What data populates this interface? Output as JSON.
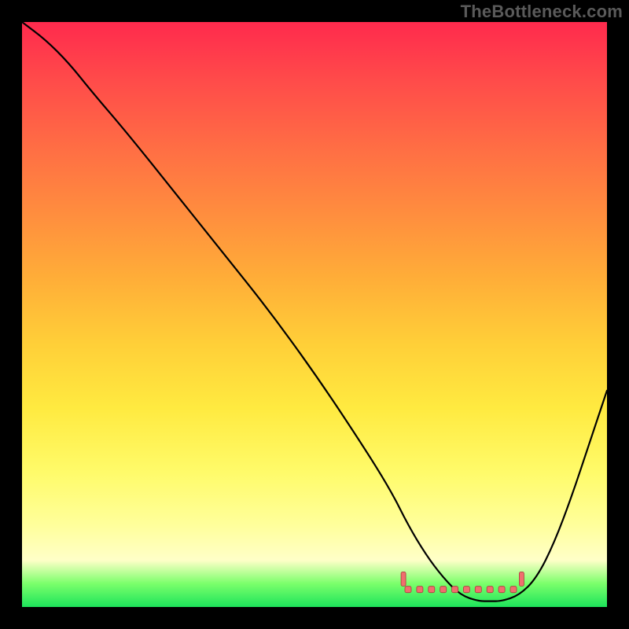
{
  "watermark": "TheBottleneck.com",
  "chart_data": {
    "type": "line",
    "title": "",
    "xlabel": "",
    "ylabel": "",
    "xlim": [
      0,
      100
    ],
    "ylim": [
      0,
      100
    ],
    "background_gradient": {
      "direction": "vertical",
      "stops": [
        {
          "pos": 0.0,
          "color": "#ff2a4d"
        },
        {
          "pos": 0.33,
          "color": "#ff8e3e"
        },
        {
          "pos": 0.66,
          "color": "#ffea40"
        },
        {
          "pos": 0.92,
          "color": "#ffffc8"
        },
        {
          "pos": 1.0,
          "color": "#1de45b"
        }
      ]
    },
    "series": [
      {
        "name": "bottleneck-curve",
        "type": "line",
        "x": [
          0,
          4,
          8,
          12,
          18,
          26,
          34,
          42,
          50,
          58,
          63,
          66,
          69,
          72,
          75,
          78,
          80,
          82,
          85,
          88,
          91,
          94,
          97,
          100
        ],
        "y": [
          100,
          97,
          93,
          88,
          81,
          71,
          61,
          51,
          40,
          28,
          20,
          14,
          9,
          5,
          2,
          1,
          1,
          1,
          2,
          5,
          11,
          19,
          28,
          37
        ]
      }
    ],
    "markers": {
      "name": "bottom-dotted-region",
      "type": "scatter",
      "x": [
        66,
        68,
        70,
        72,
        74,
        76,
        78,
        80,
        82,
        84
      ],
      "y": [
        3,
        3,
        3,
        3,
        3,
        3,
        3,
        3,
        3,
        3
      ]
    }
  }
}
